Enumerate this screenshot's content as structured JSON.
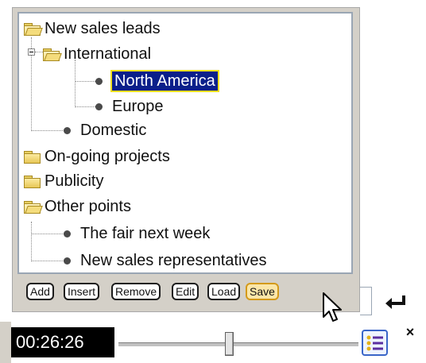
{
  "tree": {
    "nodes": [
      {
        "label": "New sales leads",
        "icon": "folder-open-icon"
      },
      {
        "label": "International",
        "icon": "folder-open-icon"
      },
      {
        "label": "North America",
        "icon": "bullet-icon",
        "selected": true
      },
      {
        "label": "Europe",
        "icon": "bullet-icon"
      },
      {
        "label": "Domestic",
        "icon": "bullet-icon"
      },
      {
        "label": "On-going projects",
        "icon": "folder-closed-icon"
      },
      {
        "label": "Publicity",
        "icon": "folder-closed-icon"
      },
      {
        "label": "Other points",
        "icon": "folder-open-icon"
      },
      {
        "label": "The fair next week",
        "icon": "bullet-icon"
      },
      {
        "label": "New sales representatives",
        "icon": "bullet-icon"
      }
    ]
  },
  "buttons": {
    "add": "Add",
    "insert": "Insert",
    "remove": "Remove",
    "edit": "Edit",
    "load": "Load",
    "save": "Save"
  },
  "player": {
    "time": "00:26:26",
    "slider_position": 0.45
  },
  "colors": {
    "selection_bg": "#0a1f8a",
    "selection_outline": "#f0e020",
    "panel_bg": "#d4d0c8",
    "active_button_bg": "#fbe6a8"
  }
}
